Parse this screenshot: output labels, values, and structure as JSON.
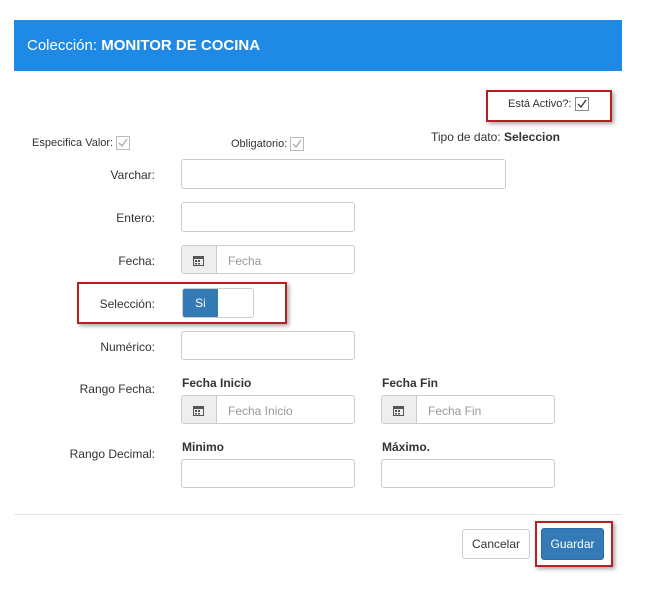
{
  "header": {
    "prefix": "Colección: ",
    "title": "MONITOR DE COCINA"
  },
  "active": {
    "label": "Está Activo?:",
    "checked": true
  },
  "specify_value": {
    "label": "Especifica Valor:",
    "checked": true
  },
  "required": {
    "label": "Obligatorio:",
    "checked": true
  },
  "data_type": {
    "label": "Tipo de dato:",
    "value": "Seleccion"
  },
  "fields": {
    "varchar": {
      "label": "Varchar:",
      "value": ""
    },
    "entero": {
      "label": "Entero:",
      "value": ""
    },
    "fecha": {
      "label": "Fecha:",
      "placeholder": "Fecha",
      "icon": "calendar-icon"
    },
    "seleccion": {
      "label": "Selección:",
      "toggle_on_label": "Si"
    },
    "numerico": {
      "label": "Numérico:",
      "value": ""
    },
    "rango_fecha": {
      "label": "Rango Fecha:",
      "start_title": "Fecha Inicio",
      "start_placeholder": "Fecha Inicio",
      "end_title": "Fecha Fin",
      "end_placeholder": "Fecha Fin"
    },
    "rango_decimal": {
      "label": "Rango Decimal:",
      "min_title": "Minimo",
      "max_title": "Máximo."
    }
  },
  "footer": {
    "cancel_label": "Cancelar",
    "save_label": "Guardar"
  },
  "colors": {
    "header_bg": "#1e8ae6",
    "primary": "#337ab7",
    "highlight": "#b22222"
  }
}
